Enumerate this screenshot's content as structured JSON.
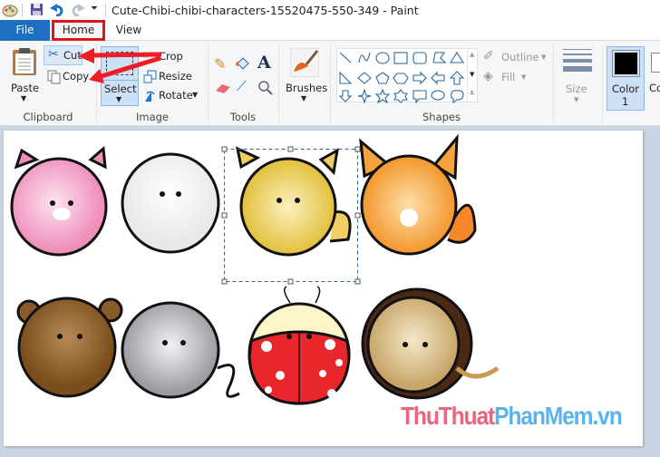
{
  "window": {
    "title": "Cute-Chibi-chibi-characters-15520475-550-349 - Paint"
  },
  "tabs": [
    {
      "label": "File"
    },
    {
      "label": "Home"
    },
    {
      "label": "View"
    }
  ],
  "clipboard": {
    "paste": "Paste",
    "cut": "Cut",
    "copy": "Copy",
    "group": "Clipboard"
  },
  "image": {
    "select": "Select",
    "crop": "Crop",
    "resize": "Resize",
    "rotate": "Rotate",
    "group": "Image"
  },
  "tools": {
    "group": "Tools"
  },
  "brushes": {
    "label": "Brushes"
  },
  "shapes": {
    "outline": "Outline",
    "fill": "Fill",
    "group": "Shapes"
  },
  "size": {
    "label": "Size"
  },
  "color1": {
    "label": "Color",
    "num": "1",
    "value": "#000000"
  },
  "color2": {
    "label": "Co"
  },
  "watermark": {
    "part1": "ThuThuat",
    "part2": "PhanMem.vn",
    "color1": "#e8667e",
    "color2": "#5ab4ea"
  },
  "colors": {
    "file_tab": "#1e6fc1",
    "highlight": "#e0141b"
  }
}
